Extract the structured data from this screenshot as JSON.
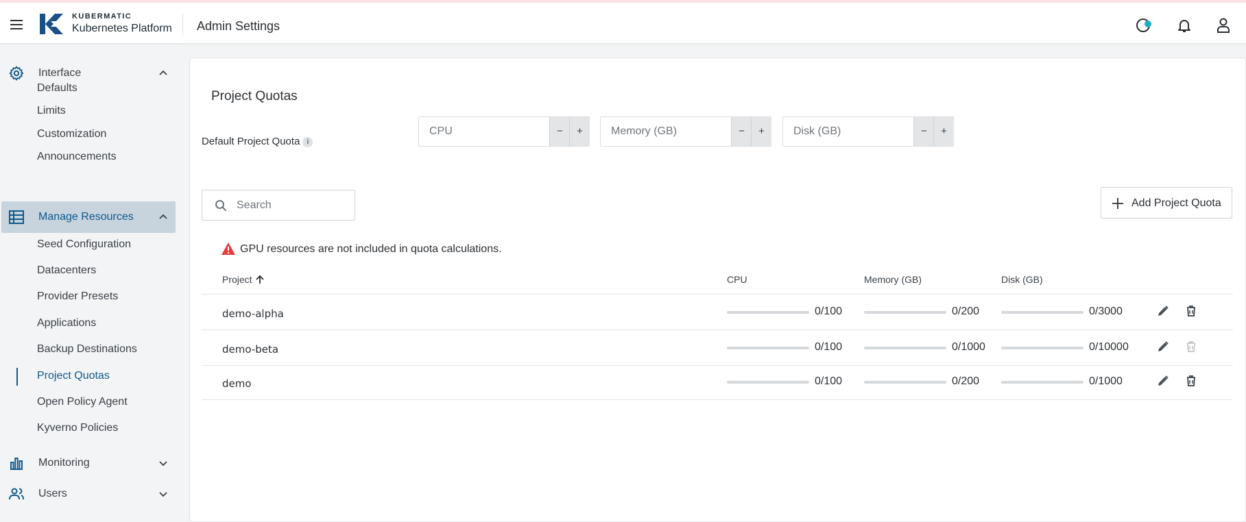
{
  "header": {
    "brand_top": "KUBERMATIC",
    "brand_bottom": "Kubernetes Platform",
    "title": "Admin Settings"
  },
  "sidebar": {
    "interface": {
      "label": "Interface",
      "items": [
        "Defaults",
        "Limits",
        "Customization",
        "Announcements"
      ]
    },
    "manage": {
      "label": "Manage Resources",
      "items": [
        "Seed Configuration",
        "Datacenters",
        "Provider Presets",
        "Applications",
        "Backup Destinations",
        "Project Quotas",
        "Open Policy Agent",
        "Kyverno Policies"
      ],
      "selected": "Project Quotas"
    },
    "monitoring": {
      "label": "Monitoring"
    },
    "users": {
      "label": "Users"
    }
  },
  "main": {
    "title": "Project Quotas",
    "default_quota_label": "Default Project Quota",
    "info_symbol": "i",
    "cpu_placeholder": "CPU",
    "memory_placeholder": "Memory (GB)",
    "disk_placeholder": "Disk (GB)",
    "minus": "−",
    "plus": "+",
    "search_placeholder": "Search",
    "add_button": "Add Project Quota",
    "warning": "GPU resources are not included in quota calculations.",
    "columns": {
      "project": "Project",
      "cpu": "CPU",
      "memory": "Memory (GB)",
      "disk": "Disk (GB)"
    },
    "rows": [
      {
        "name": "demo-alpha",
        "cpu": "0/100",
        "memory": "0/200",
        "disk": "0/3000",
        "cpu_usage": 0,
        "memory_usage": 0,
        "disk_usage": 0,
        "delete_enabled": true
      },
      {
        "name": "demo-beta",
        "cpu": "0/100",
        "memory": "0/1000",
        "disk": "0/10000",
        "cpu_usage": 0,
        "memory_usage": 0,
        "disk_usage": 0,
        "delete_enabled": false
      },
      {
        "name": "demo",
        "cpu": "0/100",
        "memory": "0/200",
        "disk": "0/1000",
        "cpu_usage": 0,
        "memory_usage": 0,
        "disk_usage": 0,
        "delete_enabled": true
      }
    ]
  },
  "colors": {
    "accent": "#0f5a8c",
    "active_bg": "#c7d3dd",
    "warning": "#e23d3d"
  },
  "icons": [
    "menu-icon",
    "kubermatic-logo-icon",
    "theme-icon",
    "bell-icon",
    "user-icon",
    "gear-icon",
    "list-icon",
    "bar-chart-icon",
    "users-icon",
    "search-icon",
    "plus-icon",
    "warning-icon",
    "edit-icon",
    "delete-icon",
    "arrow-up-icon",
    "chevron-up-icon",
    "chevron-down-icon"
  ]
}
